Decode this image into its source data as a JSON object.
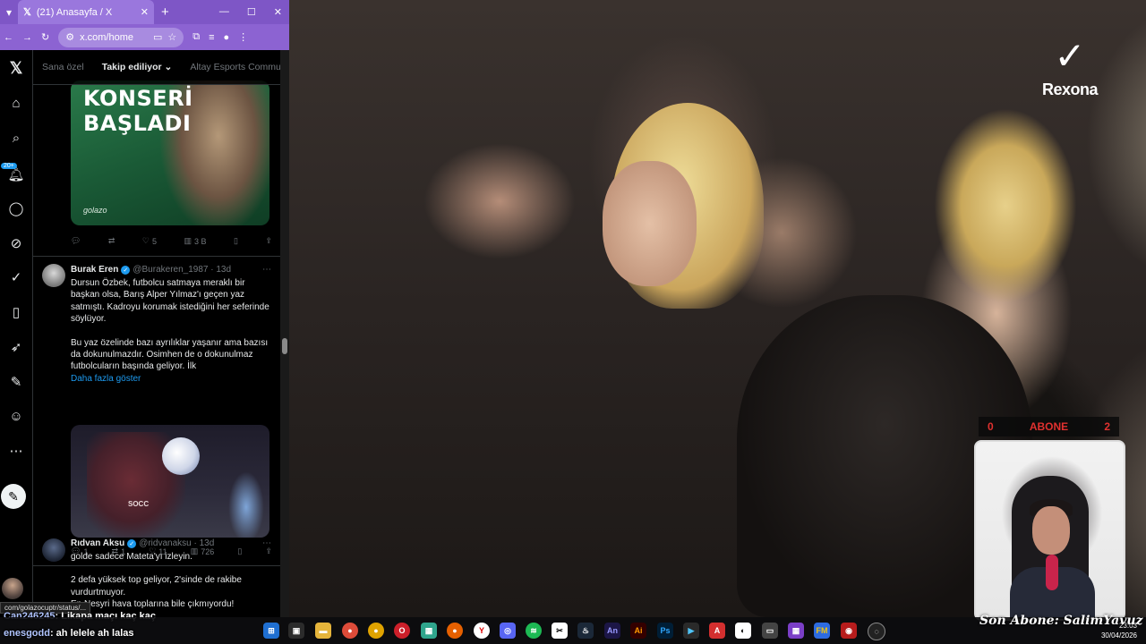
{
  "browser": {
    "tab_title": "(21) Anasayfa / X",
    "url": "x.com/home",
    "status_url": "com/golazocuptr/status/..."
  },
  "x_nav": {
    "notification_badge": "20+",
    "icons": [
      "x-logo-icon",
      "home-icon",
      "search-icon",
      "notifications-icon",
      "messages-icon",
      "grok-icon",
      "communities-icon",
      "bookmarks-icon",
      "jobs-icon",
      "premium-icon",
      "profile-icon",
      "more-icon",
      "compose-icon"
    ]
  },
  "feed_tabs": [
    {
      "label": "Sana özel"
    },
    {
      "label": "Takip ediliyor ⌄"
    },
    {
      "label": "Altay Esports Commu"
    }
  ],
  "tweet1": {
    "image_headline": [
      "KONSERİ",
      "BAŞLADI"
    ],
    "image_watermark": "golazo",
    "likes": "5",
    "views": "3 B"
  },
  "tweet2": {
    "name": "Burak Eren",
    "handle": "@Burakeren_1987 · 13d",
    "text_p1": "Dursun Özbek, futbolcu satmaya meraklı bir başkan olsa, Barış Alper Yılmaz'ı geçen yaz satmıştı. Kadroyu korumak istediğini her seferinde söylüyor.",
    "text_p2": "Bu yaz özelinde bazı ayrılıklar yaşanır ama bazısı da dokunulmazdır. Osimhen de o dokunulmaz futbolcuların başında geliyor. İlk",
    "show_more": "Daha fazla göster",
    "image_text": "SOCC",
    "replies": "1",
    "reposts": "1",
    "likes": "11",
    "views": "726"
  },
  "tweet3": {
    "name": "Rıdvan Aksu",
    "handle": "@ridvanaksu · 13d",
    "text_p1": "golde sadece Mateta'yı izleyin.",
    "text_p2": "2 defa yüksek top geliyor, 2'sinde de rakibe vurdurtmuyor.",
    "text_p3": "En Nesyri hava toplarına bile çıkmıyordu!"
  },
  "chat": [
    {
      "user": "Can246245",
      "message": ": Likapa maçı kaç kaç"
    },
    {
      "user": "enesgodd",
      "message": ": ah lelele ah lalas"
    }
  ],
  "overlay": {
    "brand": "Rexona",
    "abone_left": "0",
    "abone_label": "ABONE",
    "abone_right": "2",
    "signature": "Son Abone: SalimYavuz"
  },
  "taskbar": {
    "time": "23:03",
    "date": "30/04/2026",
    "icons": [
      "windows-start-icon",
      "task-view-icon",
      "explorer-icon",
      "chrome-icon",
      "chrome-alt-icon",
      "opera-icon",
      "app-icon",
      "firefox-icon",
      "yandex-icon",
      "discord-icon",
      "spotify-icon",
      "capcut-icon",
      "steam-icon",
      "animate-icon",
      "illustrator-icon",
      "photoshop-icon",
      "acrobat-icon",
      "files-icon",
      "media-icon",
      "monitor-icon",
      "app2-icon",
      "app3-icon",
      "record-icon",
      "obs-icon"
    ]
  }
}
